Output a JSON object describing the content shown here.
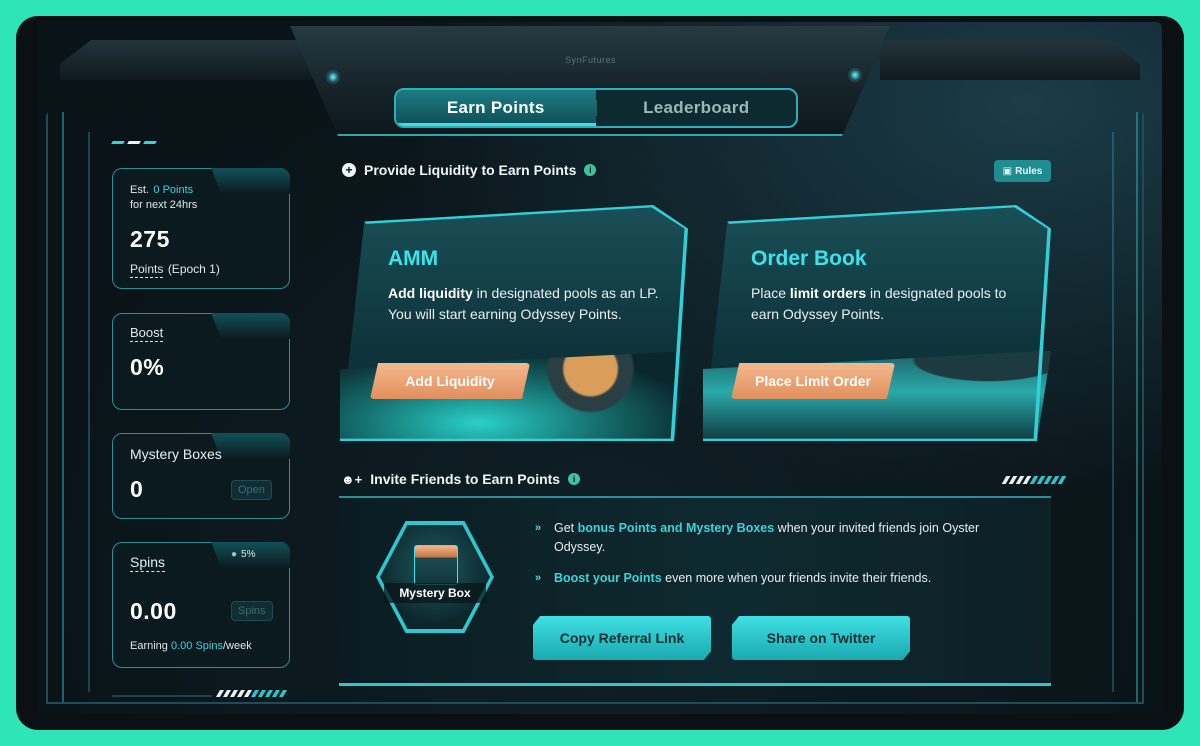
{
  "brand": "SynFutures",
  "tabs": [
    {
      "label": "Earn Points",
      "active": true
    },
    {
      "label": "Leaderboard",
      "active": false
    }
  ],
  "stats": {
    "points": {
      "est_prefix": "Est.",
      "est_value": "0 Points",
      "est_suffix": "for next 24hrs",
      "value": "275",
      "label_link": "Points",
      "label_rest": "(Epoch 1)"
    },
    "boost": {
      "label": "Boost",
      "value": "0%"
    },
    "mystery_boxes": {
      "label": "Mystery Boxes",
      "value": "0",
      "button": "Open"
    },
    "spins": {
      "label": "Spins",
      "badge": "5%",
      "value": "0.00",
      "button": "Spins",
      "earning_prefix": "Earning",
      "earning_value": "0.00 Spins",
      "earning_suffix": "/week"
    }
  },
  "liquidity_section": {
    "title": "Provide Liquidity to Earn Points",
    "rules_button": "Rules"
  },
  "amm_card": {
    "title": "AMM",
    "desc_bold": "Add liquidity",
    "desc_rest": " in designated pools as an LP. You will start earning Odyssey Points.",
    "button": "Add Liquidity"
  },
  "orderbook_card": {
    "title": "Order Book",
    "desc_pre": "Place ",
    "desc_bold": "limit orders",
    "desc_rest": " in designated pools to earn Odyssey Points.",
    "button": "Place Limit Order"
  },
  "invite_section": {
    "title": "Invite Friends to Earn Points",
    "mystery_box_label": "Mystery Box",
    "bullet1_pre": "Get ",
    "bullet1_hl": "bonus Points and Mystery Boxes",
    "bullet1_post": " when your invited friends join Oyster Odyssey.",
    "bullet2_hl": "Boost your Points",
    "bullet2_post": " even more when your friends invite their friends.",
    "copy_button": "Copy Referral Link",
    "share_button": "Share on Twitter"
  },
  "colors": {
    "accent": "#3be4ea",
    "orange": "#e8996a",
    "border": "#2b8f97",
    "background_outer": "#2ee5b8"
  }
}
